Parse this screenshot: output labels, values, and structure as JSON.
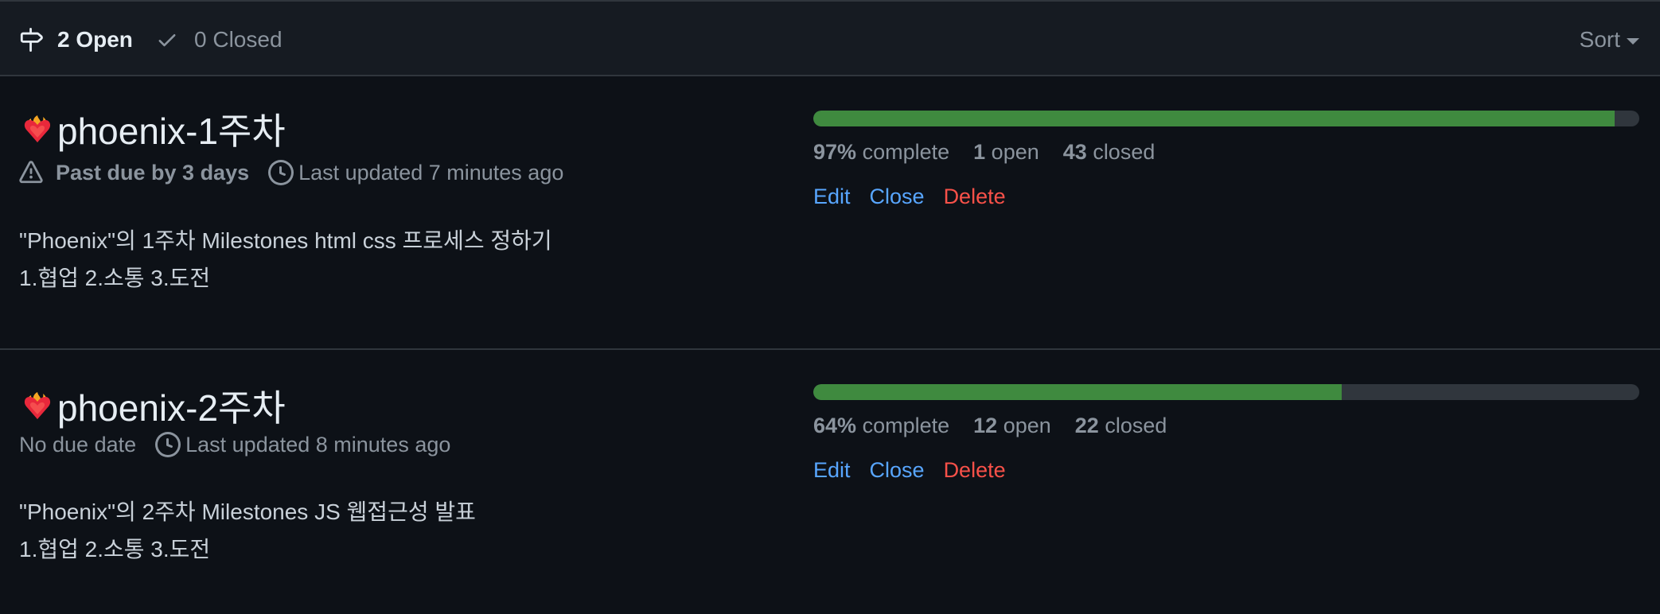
{
  "header": {
    "open_label": "2 Open",
    "closed_label": "0 Closed",
    "sort_label": "Sort"
  },
  "milestones": [
    {
      "title": "phoenix-1주차",
      "title_emoji": "heart-on-fire",
      "due": "Past due by 3 days",
      "due_icon": "alert-icon",
      "updated": "Last updated 7 minutes ago",
      "description": [
        "\"Phoenix\"의 1주차 Milestones html css 프로세스 정하기",
        "1.협업 2.소통 3.도전"
      ],
      "progress": {
        "percent": 97,
        "percent_label": "97%",
        "complete_label": "complete",
        "open_count": "1",
        "open_label": "open",
        "closed_count": "43",
        "closed_label": "closed"
      },
      "actions": {
        "edit": "Edit",
        "close": "Close",
        "delete": "Delete"
      }
    },
    {
      "title": "phoenix-2주차",
      "title_emoji": "heart-on-fire",
      "due": "No due date",
      "updated": "Last updated 8 minutes ago",
      "description": [
        "\"Phoenix\"의 2주차 Milestones JS 웹접근성 발표",
        "1.협업 2.소통 3.도전"
      ],
      "progress": {
        "percent": 64,
        "percent_label": "64%",
        "complete_label": "complete",
        "open_count": "12",
        "open_label": "open",
        "closed_count": "22",
        "closed_label": "closed"
      },
      "actions": {
        "edit": "Edit",
        "close": "Close",
        "delete": "Delete"
      }
    }
  ],
  "colors": {
    "background": "#0d1117",
    "header_bg": "#161b22",
    "progress_fill": "#3f8a3f",
    "progress_track": "#30363d",
    "link": "#58a6ff",
    "danger": "#f85149"
  }
}
